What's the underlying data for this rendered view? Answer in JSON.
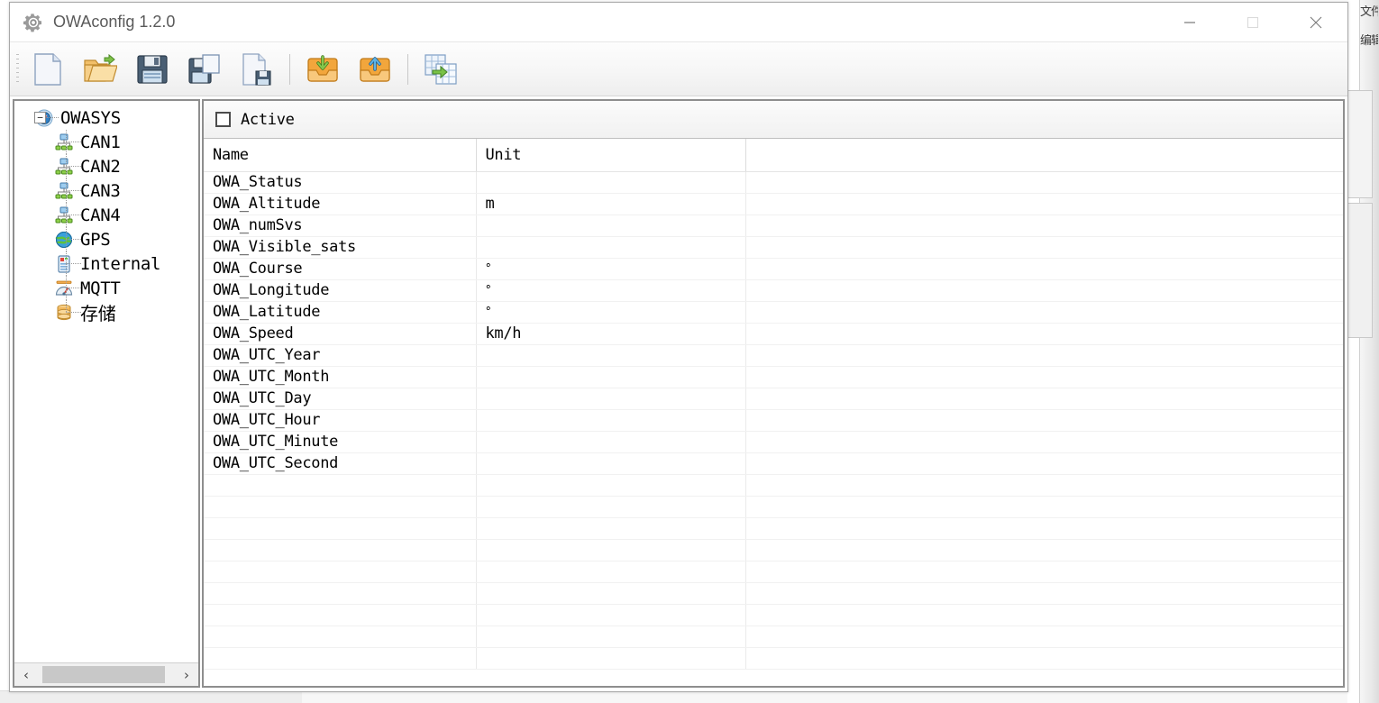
{
  "window": {
    "title": "OWAconfig 1.2.0",
    "app_icon": "gear-icon",
    "controls": {
      "minimize": "minimize-icon",
      "maximize": "maximize-icon",
      "close": "close-icon"
    }
  },
  "toolbar": {
    "buttons": [
      {
        "name": "new-file-button",
        "icon": "new-document-icon",
        "tooltip": "New"
      },
      {
        "name": "open-file-button",
        "icon": "open-folder-icon",
        "tooltip": "Open"
      },
      {
        "name": "save-button",
        "icon": "save-floppy-icon",
        "tooltip": "Save"
      },
      {
        "name": "save-as-button",
        "icon": "save-as-icon",
        "tooltip": "Save As"
      },
      {
        "name": "save-copy-button",
        "icon": "document-save-icon",
        "tooltip": "Save Copy"
      },
      {
        "name": "import-button",
        "icon": "import-tray-down-icon",
        "tooltip": "Import"
      },
      {
        "name": "export-button",
        "icon": "export-tray-up-icon",
        "tooltip": "Export"
      },
      {
        "name": "export-table-button",
        "icon": "export-spreadsheet-icon",
        "tooltip": "Export Table"
      }
    ]
  },
  "tree": {
    "root": {
      "label": "OWASYS",
      "icon": "compass-icon",
      "expander": "−",
      "expanded": true
    },
    "children": [
      {
        "label": "CAN1",
        "icon": "network-icon"
      },
      {
        "label": "CAN2",
        "icon": "network-icon"
      },
      {
        "label": "CAN3",
        "icon": "network-icon"
      },
      {
        "label": "CAN4",
        "icon": "network-icon"
      },
      {
        "label": "GPS",
        "icon": "globe-icon"
      },
      {
        "label": "Internal",
        "icon": "device-icon"
      },
      {
        "label": "MQTT",
        "icon": "gauge-icon"
      },
      {
        "label": "存储",
        "icon": "database-icon"
      }
    ],
    "scrollbar": {
      "left_arrow": "‹",
      "right_arrow": "›"
    }
  },
  "panel": {
    "active_checkbox_label": "Active",
    "active_checked": false
  },
  "table": {
    "columns": [
      "Name",
      "Unit",
      ""
    ],
    "rows": [
      {
        "name": "OWA_Status",
        "unit": "",
        "extra": ""
      },
      {
        "name": "OWA_Altitude",
        "unit": "m",
        "extra": ""
      },
      {
        "name": "OWA_numSvs",
        "unit": "",
        "extra": ""
      },
      {
        "name": "OWA_Visible_sats",
        "unit": "",
        "extra": ""
      },
      {
        "name": "OWA_Course",
        "unit": "°",
        "extra": ""
      },
      {
        "name": "OWA_Longitude",
        "unit": "°",
        "extra": ""
      },
      {
        "name": "OWA_Latitude",
        "unit": "°",
        "extra": ""
      },
      {
        "name": "OWA_Speed",
        "unit": "km/h",
        "extra": ""
      },
      {
        "name": "OWA_UTC_Year",
        "unit": "",
        "extra": ""
      },
      {
        "name": "OWA_UTC_Month",
        "unit": "",
        "extra": ""
      },
      {
        "name": "OWA_UTC_Day",
        "unit": "",
        "extra": ""
      },
      {
        "name": "OWA_UTC_Hour",
        "unit": "",
        "extra": ""
      },
      {
        "name": "OWA_UTC_Minute",
        "unit": "",
        "extra": ""
      },
      {
        "name": "OWA_UTC_Second",
        "unit": "",
        "extra": ""
      }
    ],
    "empty_row_count": 9
  },
  "background": {
    "cut_text_top": "文件",
    "cut_text_second": "编辑"
  },
  "colors": {
    "title_text": "#5a5a5a",
    "window_border": "#a8a8a8",
    "panel_border": "#8e8e8e",
    "toolbar_bg": "#f6f6f6",
    "grid_line": "#f1f1f1",
    "accent_blue": "#3a7fc1",
    "folder_orange": "#f0a94c",
    "import_green": "#6cb33f",
    "export_blue": "#4a9fd8"
  }
}
